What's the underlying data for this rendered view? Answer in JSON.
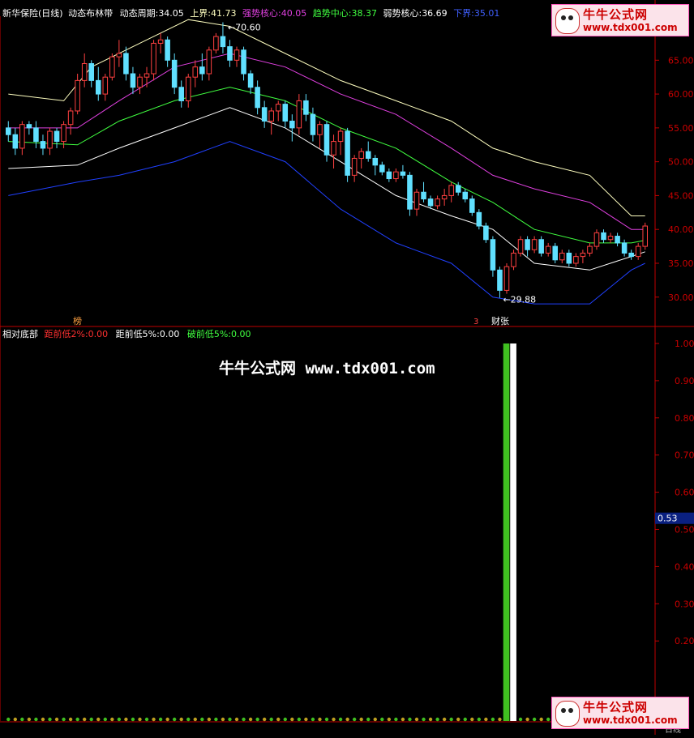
{
  "header": {
    "title": "新华保险(日线)",
    "indicator": "动态布林带",
    "period_label": "动态周期:",
    "period_value": "34.05",
    "upper_label": "上界:",
    "upper_value": "41.73",
    "strong_label": "强势核心:",
    "strong_value": "40.05",
    "trend_label": "趋势中心:",
    "trend_value": "38.37",
    "weak_label": "弱势核心:",
    "weak_value": "36.69",
    "lower_label": "下界:",
    "lower_value": "35.01"
  },
  "colors": {
    "upper": "#ffffc0",
    "strong": "#e040e0",
    "trend": "#40ff40",
    "weak": "#ffffff",
    "lower": "#2040ff",
    "up_candle": "#ff4040",
    "down_candle": "#60e0ff",
    "axis": "#c00000"
  },
  "price_axis": {
    "ticks": [
      "65.00",
      "60.00",
      "55.00",
      "50.00",
      "45.00",
      "40.00",
      "35.00",
      "30.00"
    ]
  },
  "annotations": {
    "high": "70.60",
    "low": "29.88",
    "event1": "榜",
    "event2": "财张",
    "event2b": "3"
  },
  "sub_header": {
    "title": "相对底部",
    "dist2_label": "距前低2%:",
    "dist2_value": "0.00",
    "dist5_label": "距前低5%:",
    "dist5_value": "0.00",
    "break5_label": "破前低5%:",
    "break5_value": "0.00"
  },
  "sub_axis": {
    "ticks": [
      "1.00",
      "0.90",
      "0.80",
      "0.70",
      "0.60",
      "0.50",
      "0.40",
      "0.30",
      "0.20"
    ],
    "current": "0.53"
  },
  "watermark": "牛牛公式网 www.tdx001.com",
  "logo": {
    "name": "牛牛公式网",
    "url": "www.tdx001.com"
  },
  "footer": {
    "corner": "日线"
  },
  "chart_data": {
    "type": "candlestick",
    "price_range": [
      26.5,
      71.5
    ],
    "candles": [
      [
        55,
        56,
        53,
        54
      ],
      [
        54,
        55,
        51,
        52
      ],
      [
        52,
        56,
        51,
        55.5
      ],
      [
        55.5,
        56,
        54,
        55
      ],
      [
        55,
        56,
        52,
        53
      ],
      [
        53,
        54,
        51,
        52
      ],
      [
        52,
        55,
        51,
        54.5
      ],
      [
        54.5,
        55,
        52,
        53
      ],
      [
        53,
        56,
        52,
        55.5
      ],
      [
        55.5,
        58,
        54,
        57.5
      ],
      [
        57.5,
        63,
        57,
        62
      ],
      [
        62,
        66,
        61,
        64.5
      ],
      [
        64.5,
        65,
        61,
        62
      ],
      [
        62,
        64,
        59,
        60
      ],
      [
        60,
        63,
        59,
        62.5
      ],
      [
        62.5,
        66,
        62,
        65.5
      ],
      [
        65.5,
        68,
        64,
        66
      ],
      [
        66,
        67,
        62,
        63
      ],
      [
        63,
        64,
        60,
        61
      ],
      [
        61,
        63,
        60,
        62.5
      ],
      [
        62.5,
        64,
        61,
        63
      ],
      [
        63,
        68,
        62,
        67.5
      ],
      [
        67.5,
        69,
        66,
        68
      ],
      [
        68,
        68.5,
        64,
        65
      ],
      [
        65,
        66,
        60,
        61
      ],
      [
        61,
        62,
        58,
        59
      ],
      [
        59,
        63,
        58,
        62.5
      ],
      [
        62.5,
        65,
        61,
        64
      ],
      [
        64,
        66,
        62,
        63
      ],
      [
        63,
        67,
        62,
        66.5
      ],
      [
        66.5,
        69,
        66,
        68.5
      ],
      [
        68.5,
        70.6,
        66,
        67
      ],
      [
        67,
        68,
        64,
        65
      ],
      [
        65,
        67,
        64,
        66.5
      ],
      [
        66.5,
        67,
        62,
        63
      ],
      [
        63,
        63.5,
        60,
        61
      ],
      [
        61,
        62,
        57,
        58
      ],
      [
        58,
        59,
        55,
        56
      ],
      [
        56,
        58,
        54,
        57.5
      ],
      [
        57.5,
        59,
        56,
        58.5
      ],
      [
        58.5,
        59,
        55,
        56
      ],
      [
        56,
        57,
        53,
        55
      ],
      [
        55,
        60,
        54,
        59
      ],
      [
        59,
        60,
        56,
        57
      ],
      [
        57,
        58,
        53,
        54
      ],
      [
        54,
        56,
        52,
        55.5
      ],
      [
        55.5,
        56,
        50,
        51
      ],
      [
        51,
        54,
        49,
        53
      ],
      [
        53,
        55,
        51,
        54.5
      ],
      [
        54.5,
        55,
        47,
        48
      ],
      [
        48,
        51,
        47,
        50.5
      ],
      [
        50.5,
        52,
        49,
        51.5
      ],
      [
        51.5,
        53,
        50,
        50.5
      ],
      [
        50.5,
        51,
        48,
        49.5
      ],
      [
        49.5,
        50,
        48,
        48.5
      ],
      [
        48.5,
        49,
        47,
        47.5
      ],
      [
        47.5,
        49,
        47,
        48.5
      ],
      [
        48.5,
        49.5,
        47.5,
        48
      ],
      [
        48,
        48.5,
        42,
        43
      ],
      [
        43,
        46,
        42,
        45.5
      ],
      [
        45.5,
        47,
        44,
        44.5
      ],
      [
        44.5,
        45,
        43,
        43.5
      ],
      [
        43.5,
        45,
        43,
        44.5
      ],
      [
        44.5,
        46,
        43.5,
        45
      ],
      [
        45,
        47,
        44,
        46.5
      ],
      [
        46.5,
        47,
        45,
        45.5
      ],
      [
        45.5,
        46,
        44,
        44.5
      ],
      [
        44.5,
        45,
        42,
        42.5
      ],
      [
        42.5,
        43,
        40,
        40.5
      ],
      [
        40.5,
        41,
        38,
        38.5
      ],
      [
        38.5,
        39,
        33,
        34
      ],
      [
        34,
        34.5,
        29.9,
        31
      ],
      [
        31,
        35,
        30.5,
        34.5
      ],
      [
        34.5,
        37,
        34,
        36.5
      ],
      [
        36.5,
        39,
        36,
        38.5
      ],
      [
        38.5,
        39,
        36,
        37
      ],
      [
        37,
        39,
        36.5,
        38.5
      ],
      [
        38.5,
        39,
        36,
        36.5
      ],
      [
        36.5,
        38,
        36,
        37.5
      ],
      [
        37.5,
        38,
        35,
        35.5
      ],
      [
        35.5,
        37,
        35,
        36.5
      ],
      [
        36.5,
        37,
        34.5,
        35
      ],
      [
        35,
        36.5,
        34.5,
        36
      ],
      [
        36,
        37,
        35,
        36.5
      ],
      [
        36.5,
        38,
        36,
        37.5
      ],
      [
        37.5,
        40,
        37,
        39.5
      ],
      [
        39.5,
        40,
        38,
        38.5
      ],
      [
        38.5,
        39.5,
        38,
        39
      ],
      [
        39,
        39.5,
        37.5,
        38
      ],
      [
        38,
        38.5,
        36,
        36.5
      ],
      [
        36.5,
        37,
        35.5,
        36
      ],
      [
        36,
        38,
        35.5,
        37.5
      ],
      [
        37.5,
        41,
        37,
        40.5
      ]
    ],
    "bands": {
      "upper": [
        [
          0,
          60
        ],
        [
          8,
          59
        ],
        [
          12,
          64
        ],
        [
          20,
          68
        ],
        [
          26,
          71
        ],
        [
          32,
          70
        ],
        [
          40,
          66
        ],
        [
          48,
          62
        ],
        [
          56,
          59
        ],
        [
          64,
          56
        ],
        [
          70,
          52
        ],
        [
          76,
          50
        ],
        [
          84,
          48
        ],
        [
          90,
          42
        ],
        [
          92,
          42
        ]
      ],
      "strong": [
        [
          0,
          55
        ],
        [
          10,
          55
        ],
        [
          16,
          59
        ],
        [
          24,
          64
        ],
        [
          32,
          66
        ],
        [
          40,
          64
        ],
        [
          48,
          60
        ],
        [
          56,
          57
        ],
        [
          64,
          52
        ],
        [
          70,
          48
        ],
        [
          76,
          46
        ],
        [
          84,
          44
        ],
        [
          90,
          40
        ],
        [
          92,
          40
        ]
      ],
      "trend": [
        [
          0,
          53
        ],
        [
          10,
          52.5
        ],
        [
          16,
          56
        ],
        [
          24,
          59
        ],
        [
          32,
          61
        ],
        [
          40,
          59
        ],
        [
          48,
          55
        ],
        [
          56,
          52
        ],
        [
          64,
          47
        ],
        [
          70,
          44
        ],
        [
          76,
          40
        ],
        [
          84,
          38
        ],
        [
          90,
          38
        ],
        [
          92,
          38.4
        ]
      ],
      "weak": [
        [
          0,
          49
        ],
        [
          10,
          49.5
        ],
        [
          16,
          52
        ],
        [
          24,
          55
        ],
        [
          32,
          58
        ],
        [
          40,
          55
        ],
        [
          48,
          50
        ],
        [
          56,
          45
        ],
        [
          64,
          42
        ],
        [
          70,
          40
        ],
        [
          76,
          35
        ],
        [
          84,
          34
        ],
        [
          90,
          36
        ],
        [
          92,
          36.7
        ]
      ],
      "lower": [
        [
          0,
          45
        ],
        [
          10,
          47
        ],
        [
          16,
          48
        ],
        [
          24,
          50
        ],
        [
          32,
          53
        ],
        [
          40,
          50
        ],
        [
          48,
          43
        ],
        [
          56,
          38
        ],
        [
          64,
          35
        ],
        [
          70,
          30
        ],
        [
          76,
          29
        ],
        [
          84,
          29
        ],
        [
          90,
          34
        ],
        [
          92,
          35
        ]
      ]
    },
    "sub_bars": [
      {
        "index": 72,
        "value": 1.0,
        "color": "#40c020"
      },
      {
        "index": 73,
        "value": 1.0,
        "color": "#ffffff"
      }
    ]
  }
}
